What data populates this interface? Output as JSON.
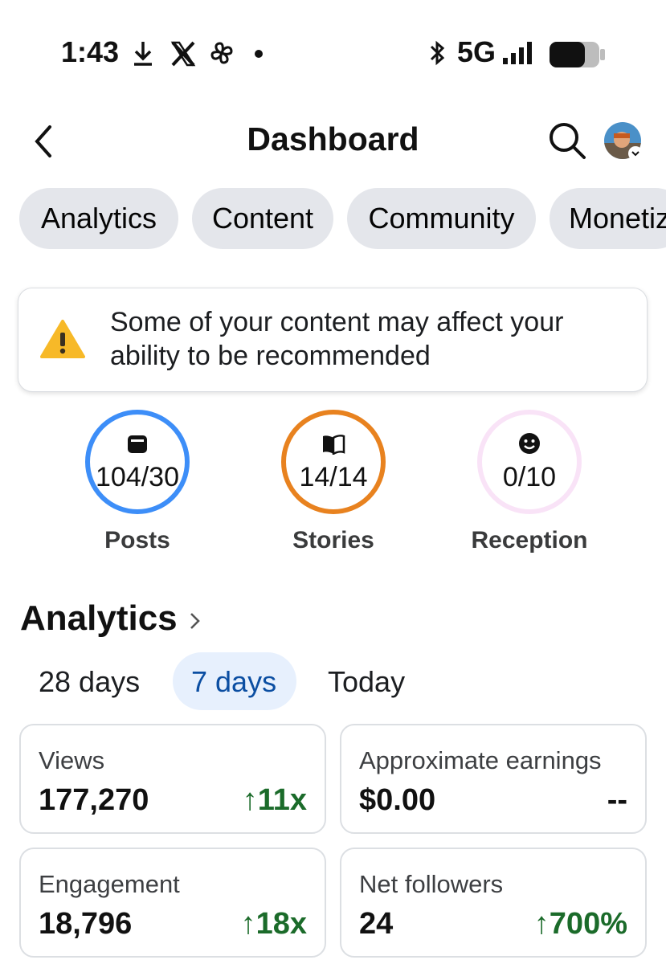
{
  "status_bar": {
    "time": "1:43",
    "network": "5G",
    "icons": [
      "download-icon",
      "x-logo-icon",
      "pinwheel-icon",
      "dot-icon",
      "bluetooth-icon",
      "signal-icon",
      "battery-icon"
    ]
  },
  "header": {
    "title": "Dashboard",
    "back_icon": "chevron-left-icon",
    "search_icon": "search-icon",
    "avatar_icon": "avatar"
  },
  "tabs": [
    "Analytics",
    "Content",
    "Community",
    "Monetiz"
  ],
  "warning": {
    "icon": "warning-icon",
    "text": "Some of your content may affect your ability to be recommended",
    "color": "#f7b928"
  },
  "rings": [
    {
      "label": "Posts",
      "value": "104/30",
      "icon": "posts-icon",
      "color": "#3d8ef8"
    },
    {
      "label": "Stories",
      "value": "14/14",
      "icon": "book-icon",
      "color": "#e8821f"
    },
    {
      "label": "Reception",
      "value": "0/10",
      "icon": "smiley-icon",
      "color": "#f9e3f7"
    }
  ],
  "analytics": {
    "title": "Analytics",
    "chevron_icon": "chevron-right-icon",
    "ranges": [
      "28 days",
      "7 days",
      "Today"
    ],
    "selected_range": "7 days",
    "selected_color": "#0b4ea2",
    "cards": [
      {
        "label": "Views",
        "value": "177,270",
        "delta": "↑11x"
      },
      {
        "label": "Approximate earnings",
        "value": "$0.00",
        "delta": "--"
      },
      {
        "label": "Engagement",
        "value": "18,796",
        "delta": "↑18x"
      },
      {
        "label": "Net followers",
        "value": "24",
        "delta": "↑700%"
      }
    ]
  }
}
